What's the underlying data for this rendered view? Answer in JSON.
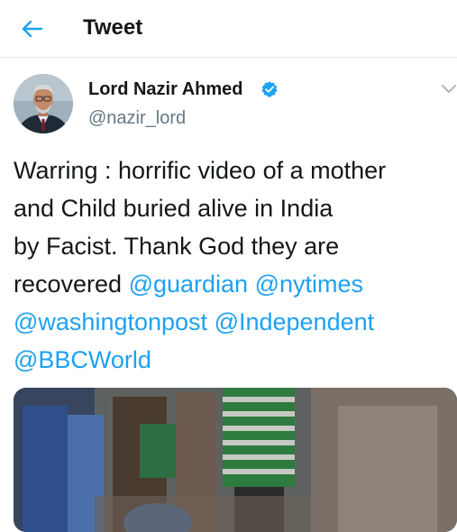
{
  "header": {
    "title": "Tweet",
    "back_icon": "arrow-left-icon"
  },
  "colors": {
    "accent": "#1da1f2",
    "text": "#14171a",
    "secondary": "#657786",
    "divider": "#e6ecf0"
  },
  "tweet": {
    "author_name": "Lord Nazir Ahmed",
    "handle": "@nazir_lord",
    "verified": true,
    "text_lines": [
      "Warring : horrific video of a mother",
      "and Child buried alive in India",
      "by Facist. Thank God they are",
      "recovered "
    ],
    "mentions": [
      "@guardian",
      "@nytimes",
      "@washingtonpost",
      "@Independent",
      "@BBCWorld"
    ]
  }
}
